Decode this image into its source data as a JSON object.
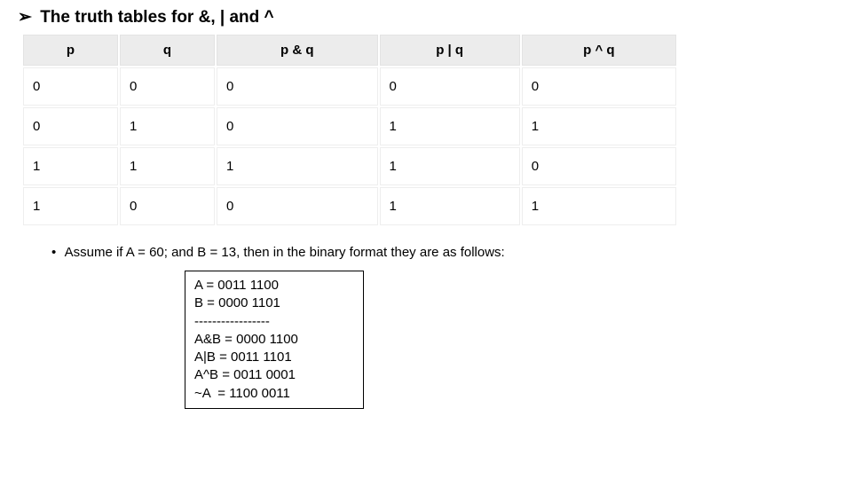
{
  "heading": "The truth tables for &, | and ^",
  "table": {
    "headers": [
      "p",
      "q",
      "p & q",
      "p | q",
      "p ^ q"
    ],
    "rows": [
      [
        "0",
        "0",
        "0",
        "0",
        "0"
      ],
      [
        "0",
        "1",
        "0",
        "1",
        "1"
      ],
      [
        "1",
        "1",
        "1",
        "1",
        "0"
      ],
      [
        "1",
        "0",
        "0",
        "1",
        "1"
      ]
    ]
  },
  "bullet": "Assume if A = 60; and B = 13, then in the binary format they are as follows:",
  "code": {
    "l1": "A = 0011 1100",
    "l2": "B = 0000 1101",
    "l3": "-----------------",
    "l4": "A&B = 0000 1100",
    "l5": "A|B = 0011 1101",
    "l6": "A^B = 0011 0001",
    "l7": "~A  = 1100 0011"
  },
  "chart_data": {
    "type": "table",
    "title": "Truth tables for &, | and ^",
    "columns": [
      "p",
      "q",
      "p & q",
      "p | q",
      "p ^ q"
    ],
    "rows": [
      [
        0,
        0,
        0,
        0,
        0
      ],
      [
        0,
        1,
        0,
        1,
        1
      ],
      [
        1,
        1,
        1,
        1,
        0
      ],
      [
        1,
        0,
        0,
        1,
        1
      ]
    ]
  }
}
